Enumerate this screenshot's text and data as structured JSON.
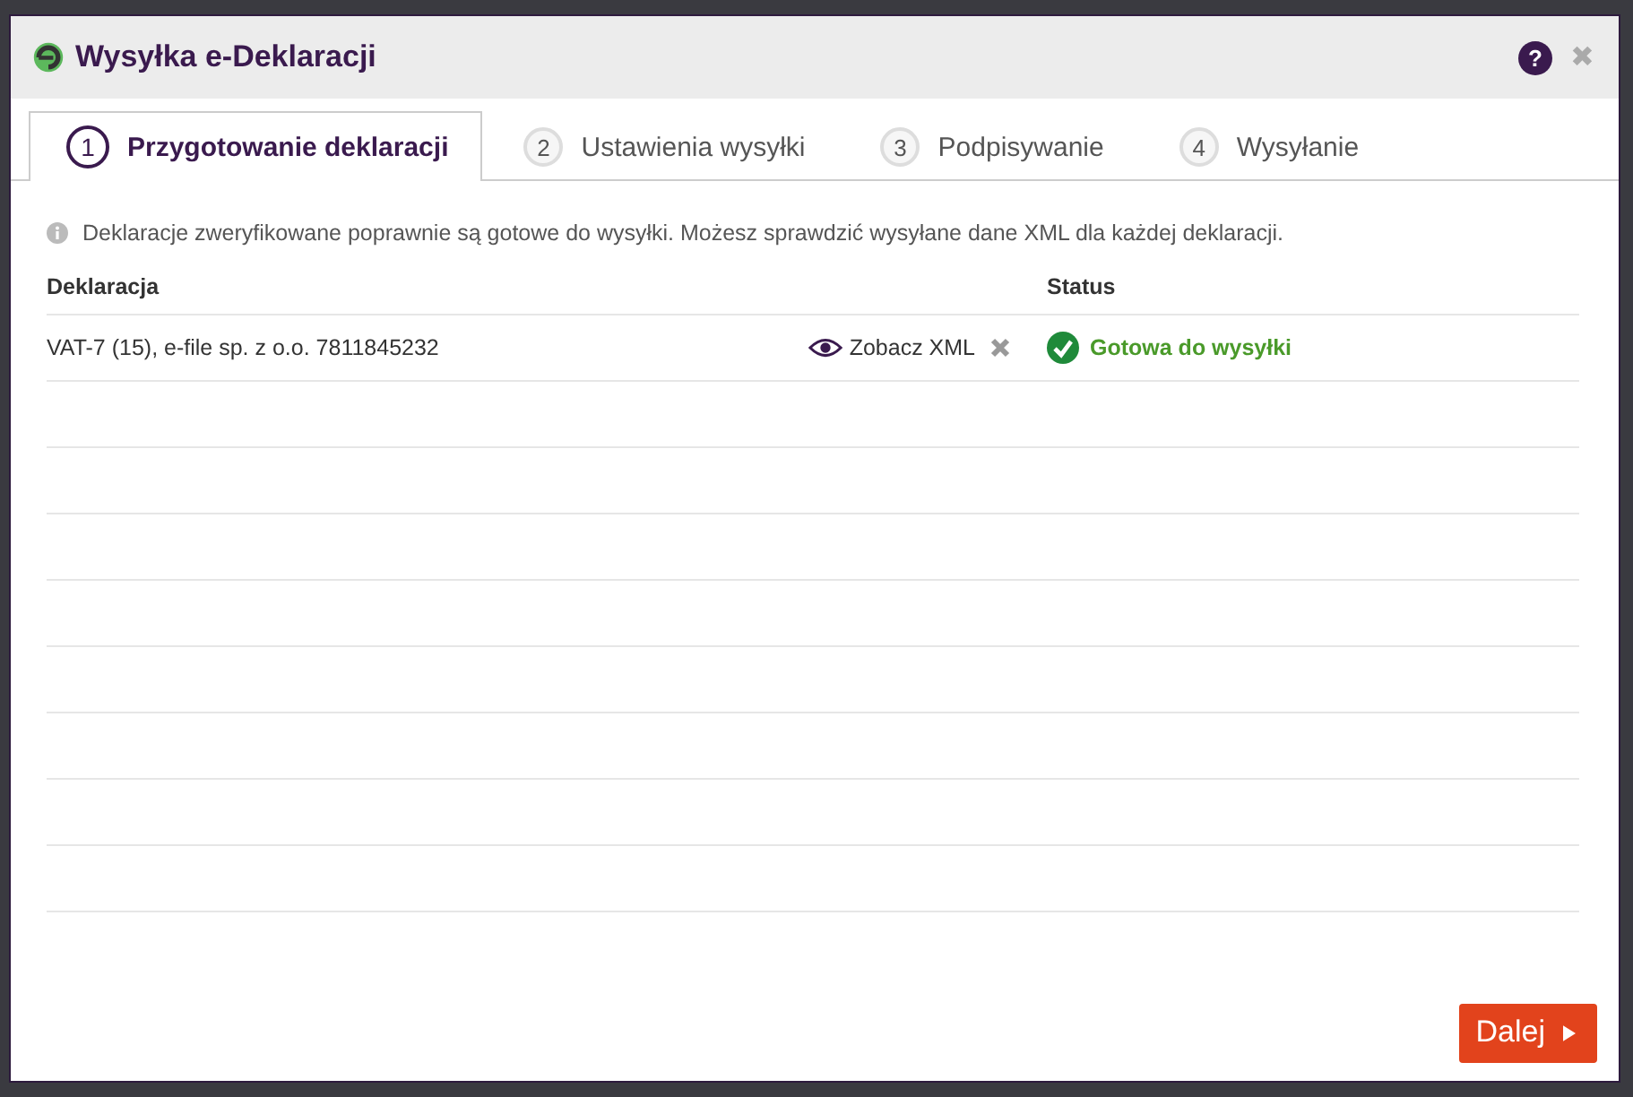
{
  "window": {
    "title": "Wysyłka e-Deklaracji",
    "help_icon": "?",
    "close": "✖"
  },
  "tabs": [
    {
      "number": "1",
      "label": "Przygotowanie deklaracji",
      "selected": true
    },
    {
      "number": "2",
      "label": "Ustawienia wysyłki",
      "selected": false
    },
    {
      "number": "3",
      "label": "Podpisywanie",
      "selected": false
    },
    {
      "number": "4",
      "label": "Wysyłanie",
      "selected": false
    }
  ],
  "info": "Deklaracje zweryfikowane poprawnie są gotowe do wysyłki. Możesz sprawdzić wysyłane dane XML dla każdej deklaracji.",
  "table": {
    "columns": [
      "Deklaracja",
      "Status"
    ],
    "rows": [
      {
        "name": "VAT-7 (15), e-file sp. z o.o. 7811845232",
        "view_link": "Zobacz XML",
        "status": "Gotowa do wysyłki",
        "color": "#4a9a2a"
      }
    ]
  },
  "buttons": [
    {
      "label": "Dalej"
    }
  ]
}
